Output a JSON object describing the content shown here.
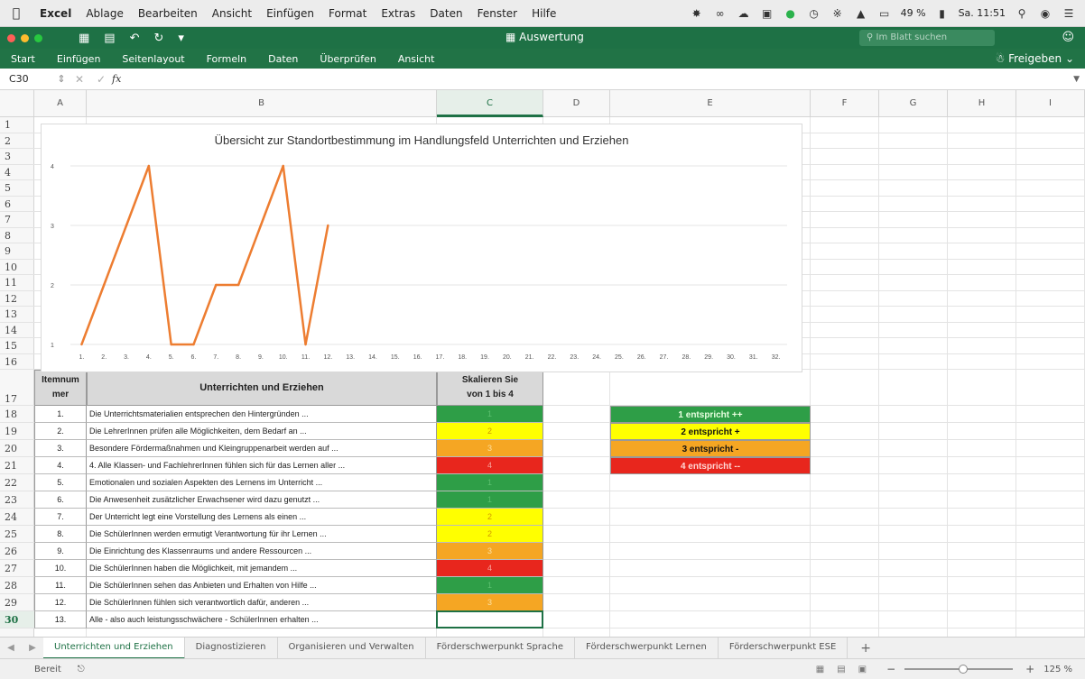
{
  "menubar": {
    "app_name": "Excel",
    "items": [
      "Ablage",
      "Bearbeiten",
      "Ansicht",
      "Einfügen",
      "Format",
      "Extras",
      "Daten",
      "Fenster",
      "Hilfe"
    ],
    "battery": "49 %",
    "clock": "Sa. 11:51"
  },
  "window": {
    "title": "Auswertung",
    "search_placeholder": "Im Blatt suchen"
  },
  "ribbon": {
    "tabs": [
      "Start",
      "Einfügen",
      "Seitenlayout",
      "Formeln",
      "Daten",
      "Überprüfen",
      "Ansicht"
    ],
    "share_label": "Freigeben"
  },
  "formula_bar": {
    "name_box": "C30",
    "fx_label": "fx"
  },
  "grid": {
    "columns": [
      "A",
      "B",
      "C",
      "D",
      "E",
      "F",
      "G",
      "H",
      "I"
    ],
    "rows": [
      "1",
      "2",
      "3",
      "4",
      "5",
      "6",
      "7",
      "8",
      "9",
      "10",
      "11",
      "12",
      "13",
      "14",
      "15",
      "16",
      "17",
      "18",
      "19",
      "20",
      "21",
      "22",
      "23",
      "24",
      "25",
      "26",
      "27",
      "28",
      "29",
      "30"
    ],
    "selected_column": "C",
    "selected_row": "30"
  },
  "chart_data": {
    "type": "line",
    "title": "Übersicht zur Standortbestimmung im Handlungsfeld Unterrichten und Erziehen",
    "x": [
      "1.",
      "2.",
      "3.",
      "4.",
      "5.",
      "6.",
      "7.",
      "8.",
      "9.",
      "10.",
      "11.",
      "12.",
      "13.",
      "14.",
      "15.",
      "16.",
      "17.",
      "18.",
      "19.",
      "20.",
      "21.",
      "22.",
      "23.",
      "24.",
      "25.",
      "26.",
      "27.",
      "28.",
      "29.",
      "30.",
      "31.",
      "32."
    ],
    "series": [
      {
        "values": [
          1,
          2,
          3,
          4,
          1,
          1,
          2,
          2,
          3,
          4,
          1,
          3
        ],
        "color": "#ed7d31"
      }
    ],
    "y_ticks": [
      "1",
      "2",
      "3",
      "4"
    ],
    "ylim": [
      1,
      4
    ],
    "grid": true,
    "legend": false
  },
  "table": {
    "header_num": "Itemnummer",
    "header_num_line1": "Itemnum",
    "header_num_line2": "mer",
    "header_title": "Unterrichten und Erziehen",
    "header_score_line1": "Skalieren Sie",
    "header_score_line2": "von 1 bis 4",
    "rows": [
      {
        "num": "1.",
        "text": "Die Unterrichtsmaterialien entsprechen den Hintergründen ...",
        "score": "1"
      },
      {
        "num": "2.",
        "text": "Die LehrerInnen prüfen alle Möglichkeiten, dem Bedarf an ...",
        "score": "2"
      },
      {
        "num": "3.",
        "text": "Besondere Fördermaßnahmen und Kleingruppenarbeit werden auf ...",
        "score": "3"
      },
      {
        "num": "4.",
        "text": "4. Alle Klassen- und FachlehrerInnen fühlen sich für das Lernen aller ...",
        "score": "4"
      },
      {
        "num": "5.",
        "text": "Emotionalen und sozialen Aspekten des Lernens im Unterricht ...",
        "score": "1"
      },
      {
        "num": "6.",
        "text": "Die Anwesenheit zusätzlicher Erwachsener wird dazu genutzt ...",
        "score": "1"
      },
      {
        "num": "7.",
        "text": "Der Unterricht legt eine Vorstellung des Lernens als einen ...",
        "score": "2"
      },
      {
        "num": "8.",
        "text": "Die SchülerInnen werden ermutigt Verantwortung für ihr Lernen ...",
        "score": "2"
      },
      {
        "num": "9.",
        "text": "Die Einrichtung des Klassenraums und andere Ressourcen ...",
        "score": "3"
      },
      {
        "num": "10.",
        "text": "Die SchülerInnen haben die Möglichkeit, mit jemandem ...",
        "score": "4"
      },
      {
        "num": "11.",
        "text": "Die SchülerInnen sehen das Anbieten und Erhalten von Hilfe ...",
        "score": "1"
      },
      {
        "num": "12.",
        "text": "Die SchülerInnen fühlen sich verantwortlich dafür, anderen ...",
        "score": "3"
      },
      {
        "num": "13.",
        "text": "Alle - also auch leistungsschwächere - SchülerInnen erhalten ...",
        "score": ""
      }
    ]
  },
  "score_colors": {
    "1": "#2e9e47",
    "2": "#ffff00",
    "3": "#f5a623",
    "4": "#e8261d"
  },
  "legend_box": [
    {
      "label": "1 entspricht ++",
      "color": "#2e9e47"
    },
    {
      "label": "2 entspricht +",
      "color": "#ffff00"
    },
    {
      "label": "3 entspricht -",
      "color": "#f5a623"
    },
    {
      "label": "4 entspricht --",
      "color": "#e8261d"
    }
  ],
  "sheet_tabs": [
    "Unterrichten und Erziehen",
    "Diagnostizieren",
    "Organisieren und Verwalten",
    "Förderschwerpunkt Sprache",
    "Förderschwerpunkt Lernen",
    "Förderschwerpunkt ESE"
  ],
  "active_sheet": "Unterrichten und Erziehen",
  "status": {
    "ready": "Bereit",
    "zoom": "125 %"
  }
}
